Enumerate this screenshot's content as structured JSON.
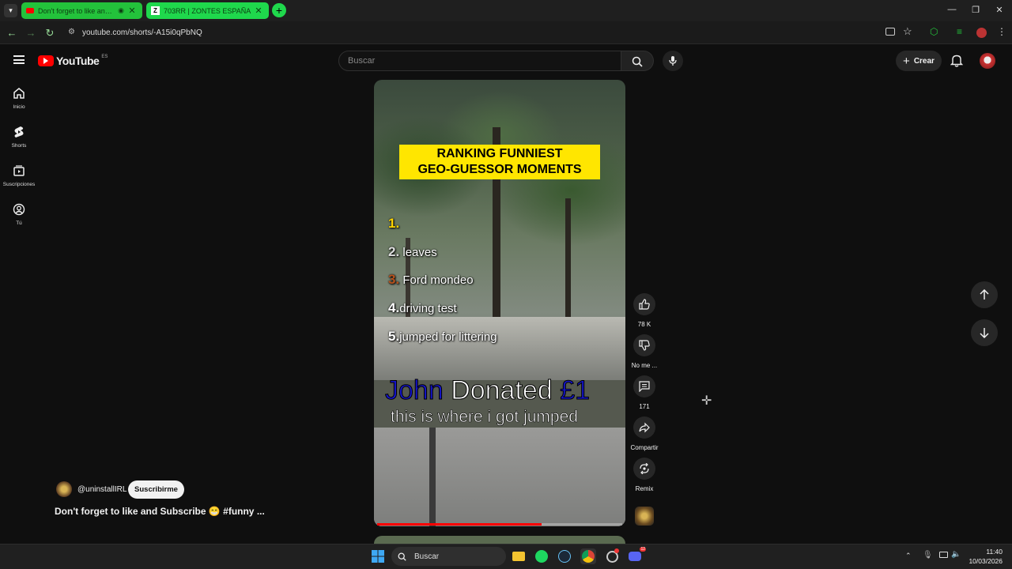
{
  "browser": {
    "tabs": [
      {
        "title": "Don't forget to like and Sub",
        "active": true
      },
      {
        "title": "703RR | ZONTES ESPAÑA",
        "active": false
      }
    ],
    "url": "youtube.com/shorts/-A15i0qPbNQ",
    "colors": {
      "tab_active": "#23c23b",
      "tab_inactive": "#1fd84c",
      "accent": "#9adf9a"
    }
  },
  "youtube": {
    "logo_text": "YouTube",
    "region": "ES",
    "search_placeholder": "Buscar",
    "create_label": "Crear",
    "sidebar": [
      {
        "label": "Inicio",
        "icon": "home-icon"
      },
      {
        "label": "Shorts",
        "icon": "shorts-icon"
      },
      {
        "label": "Suscripciones",
        "icon": "subscriptions-icon"
      },
      {
        "label": "Tú",
        "icon": "user-icon"
      }
    ]
  },
  "short": {
    "overlay_title": [
      "RANKING FUNNIEST",
      "GEO-GUESSOR MOMENTS"
    ],
    "ranking": [
      {
        "num": "1.",
        "text": ""
      },
      {
        "num": "2.",
        "text": "leaves"
      },
      {
        "num": "3.",
        "text": "Ford mondeo"
      },
      {
        "num": "4.",
        "text": "driving test"
      },
      {
        "num": "5.",
        "text": "jumped for littering"
      }
    ],
    "donation": {
      "name": "John",
      "verb": "Donated",
      "amount": "£1"
    },
    "caption": "this is where i got jumped",
    "progress": 0.67,
    "channel": "@uninstallIRL",
    "subscribe_label": "Suscribirme",
    "description": "Don't forget to like and Subscribe 😁 #funny ...",
    "actions": {
      "likes": "78 K",
      "dislike": "No me ...",
      "comments": "171",
      "share": "Compartir",
      "remix": "Remix"
    }
  },
  "taskbar": {
    "search_placeholder": "Buscar",
    "time": "11:40",
    "date": "10/03/2026",
    "discord_badge": "12"
  }
}
